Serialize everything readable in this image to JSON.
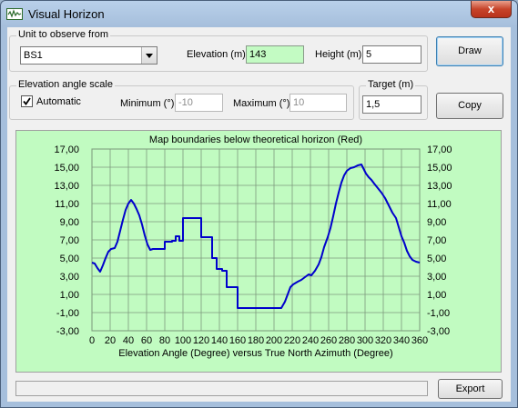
{
  "window": {
    "title": "Visual Horizon",
    "close_glyph": "x",
    "app_icon": "waveform-icon"
  },
  "unit_group": {
    "legend": "Unit to observe from",
    "selected_unit": "BS1",
    "elevation_label": "Elevation (m)",
    "elevation_value": "143",
    "height_label": "Height (m)",
    "height_value": "5"
  },
  "scale_group": {
    "legend": "Elevation angle scale",
    "automatic_label": "Automatic",
    "automatic_checked": true,
    "minimum_label": "Minimum (°)",
    "minimum_value": "-10",
    "maximum_label": "Maximum (°)",
    "maximum_value": "10"
  },
  "target_group": {
    "legend": "Target (m)",
    "value": "1,5"
  },
  "buttons": {
    "draw": "Draw",
    "copy": "Copy",
    "export": "Export"
  },
  "chart_data": {
    "type": "line",
    "title": "Map boundaries below theoretical horizon (Red)",
    "xlabel": "Elevation Angle (Degree) versus True North Azimuth (Degree)",
    "ylabel": "",
    "xlim": [
      0,
      360
    ],
    "ylim": [
      -3,
      17
    ],
    "x_ticks": [
      0,
      20,
      40,
      60,
      80,
      100,
      120,
      140,
      160,
      180,
      200,
      220,
      240,
      260,
      280,
      300,
      320,
      340,
      360
    ],
    "y_ticks": [
      "17,00",
      "15,00",
      "13,00",
      "11,00",
      "9,00",
      "7,00",
      "5,00",
      "3,00",
      "1,00",
      "-1,00",
      "-3,00"
    ],
    "grid": true,
    "line_color": "#0000cc",
    "background": "#c1fbc1",
    "series": [
      {
        "points": [
          [
            0,
            4.5
          ],
          [
            3,
            4.4
          ],
          [
            6,
            3.9
          ],
          [
            9,
            3.5
          ],
          [
            12,
            4.2
          ],
          [
            15,
            5
          ],
          [
            18,
            5.7
          ],
          [
            21,
            6
          ],
          [
            25,
            6.1
          ],
          [
            28,
            6.8
          ],
          [
            31,
            8
          ],
          [
            34,
            9.2
          ],
          [
            37,
            10.3
          ],
          [
            40,
            11
          ],
          [
            43,
            11.4
          ],
          [
            46,
            11
          ],
          [
            49,
            10.4
          ],
          [
            52,
            9.7
          ],
          [
            55,
            8.7
          ],
          [
            58,
            7.5
          ],
          [
            61,
            6.5
          ],
          [
            64,
            5.9
          ],
          [
            67,
            6
          ],
          [
            70,
            6
          ],
          [
            75,
            6
          ],
          [
            80,
            6
          ],
          [
            80,
            6.8
          ],
          [
            85,
            6.8
          ],
          [
            88,
            6.8
          ],
          [
            88,
            6.9
          ],
          [
            92,
            6.9
          ],
          [
            92,
            7.4
          ],
          [
            96,
            7.4
          ],
          [
            96,
            6.9
          ],
          [
            100,
            6.9
          ],
          [
            100,
            9.4
          ],
          [
            120,
            9.4
          ],
          [
            120,
            7.3
          ],
          [
            132,
            7.3
          ],
          [
            132,
            5
          ],
          [
            137,
            5
          ],
          [
            137,
            3.8
          ],
          [
            143,
            3.8
          ],
          [
            143,
            3.6
          ],
          [
            148,
            3.6
          ],
          [
            148,
            1.8
          ],
          [
            160,
            1.8
          ],
          [
            160,
            -0.5
          ],
          [
            182,
            -0.5
          ],
          [
            208,
            -0.5
          ],
          [
            212,
            0.2
          ],
          [
            215,
            1
          ],
          [
            218,
            1.8
          ],
          [
            221,
            2.1
          ],
          [
            226,
            2.4
          ],
          [
            230,
            2.6
          ],
          [
            234,
            2.9
          ],
          [
            238,
            3.2
          ],
          [
            241,
            3.1
          ],
          [
            245,
            3.6
          ],
          [
            249,
            4.3
          ],
          [
            252,
            5.1
          ],
          [
            255,
            6.2
          ],
          [
            259,
            7.3
          ],
          [
            262,
            8.3
          ],
          [
            265,
            9.6
          ],
          [
            268,
            11
          ],
          [
            271,
            12.2
          ],
          [
            274,
            13.3
          ],
          [
            277,
            14.1
          ],
          [
            280,
            14.6
          ],
          [
            284,
            14.9
          ],
          [
            288,
            15
          ],
          [
            292,
            15.2
          ],
          [
            296,
            15.3
          ],
          [
            298,
            14.9
          ],
          [
            301,
            14.3
          ],
          [
            304,
            13.9
          ],
          [
            307,
            13.6
          ],
          [
            310,
            13.2
          ],
          [
            314,
            12.7
          ],
          [
            318,
            12.2
          ],
          [
            322,
            11.6
          ],
          [
            326,
            10.8
          ],
          [
            330,
            10
          ],
          [
            334,
            9.4
          ],
          [
            337,
            8.4
          ],
          [
            340,
            7.4
          ],
          [
            343,
            6.7
          ],
          [
            346,
            5.8
          ],
          [
            349,
            5.2
          ],
          [
            352,
            4.8
          ],
          [
            356,
            4.6
          ],
          [
            360,
            4.5
          ]
        ]
      }
    ]
  }
}
